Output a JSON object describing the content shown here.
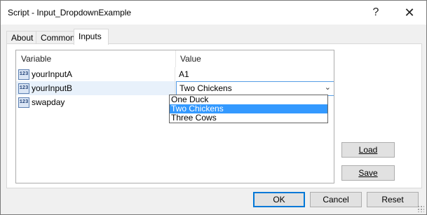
{
  "window": {
    "title": "Script - Input_DropdownExample",
    "help_glyph": "?",
    "close_glyph": "✕"
  },
  "tabs": [
    {
      "label": "About"
    },
    {
      "label": "Common"
    },
    {
      "label": "Inputs",
      "active": true
    }
  ],
  "grid": {
    "header_variable": "Variable",
    "header_value": "Value",
    "type_icon_text": "123",
    "rows": [
      {
        "variable": "yourInputA",
        "value": "A1"
      },
      {
        "variable": "yourInputB",
        "value": "Two Chickens",
        "editing": true
      },
      {
        "variable": "swapday",
        "value": ""
      }
    ]
  },
  "dropdown": {
    "arrow_glyph": "⌄",
    "options": [
      "One Duck",
      "Two Chickens",
      "Three Cows"
    ],
    "selected": "Two Chickens"
  },
  "side_buttons": {
    "load_label": "Load",
    "save_label": "Save"
  },
  "footer": {
    "ok_label": "OK",
    "cancel_label": "Cancel",
    "reset_label": "Reset"
  }
}
